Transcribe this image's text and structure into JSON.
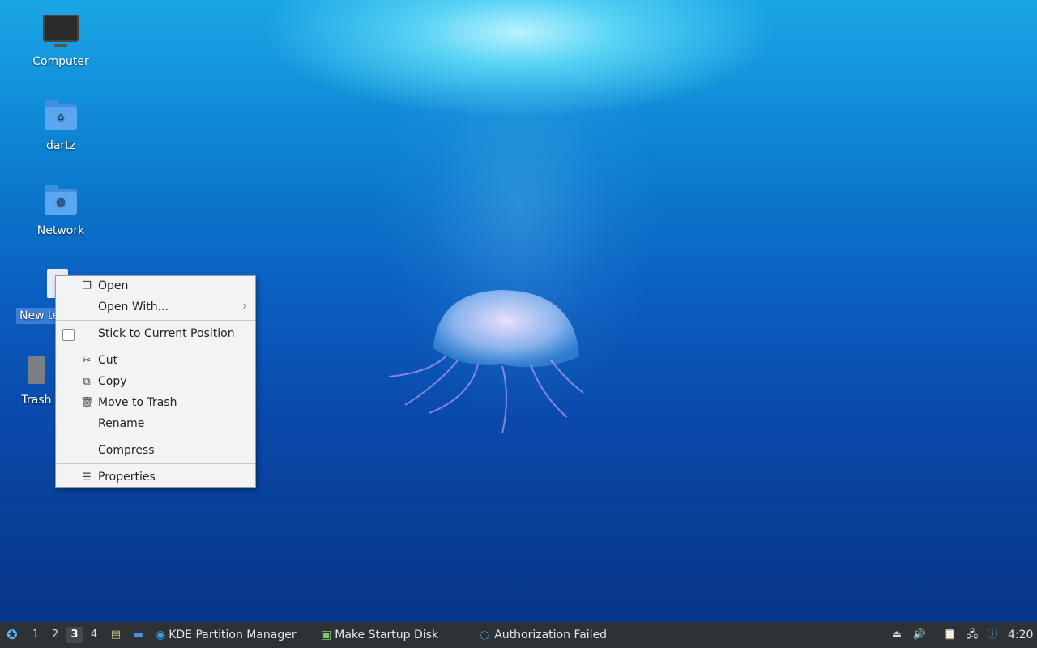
{
  "desktop": {
    "icons": [
      {
        "label": "Computer"
      },
      {
        "label": "dartz"
      },
      {
        "label": "Network"
      },
      {
        "label": "New te"
      },
      {
        "label": "Trash"
      }
    ]
  },
  "context_menu": {
    "items": {
      "open": "Open",
      "open_with": "Open With...",
      "stick": "Stick to Current Position",
      "cut": "Cut",
      "copy": "Copy",
      "trash": "Move to Trash",
      "rename": "Rename",
      "compress": "Compress",
      "properties": "Properties"
    }
  },
  "taskbar": {
    "workspaces": [
      "1",
      "2",
      "3",
      "4"
    ],
    "active_workspace": "3",
    "tasks": {
      "kde": "KDE Partition Manager",
      "startup": "Make Startup Disk",
      "auth": "Authorization Failed"
    },
    "clock": "4:20"
  },
  "icons": {
    "start": "lubuntu-logo-icon",
    "file_manager": "file-manager-icon",
    "show_desktop": "show-desktop-icon",
    "volume": "volume-icon",
    "network": "network-icon",
    "clipboard": "clipboard-icon",
    "update": "update-notifier-icon"
  },
  "colors": {
    "taskbar_bg": "#2e3234",
    "selection": "#3d7fd9",
    "menu_bg": "#f3f3f3"
  }
}
